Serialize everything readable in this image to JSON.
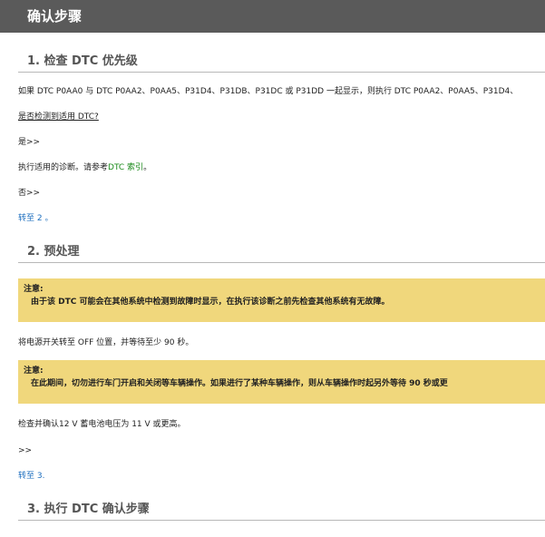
{
  "page_title": "确认步骤",
  "sections": [
    {
      "title": "1. 检查 DTC 优先级"
    },
    {
      "title": "2. 预处理"
    },
    {
      "title": "3. 执行 DTC 确认步骤"
    }
  ],
  "step1": {
    "intro": "如果 DTC P0AA0 与 DTC P0AA2、P0AA5、P31D4、P31DB、P31DC 或 P31DD 一起显示，则执行 DTC P0AA2、P0AA5、P31D4、",
    "question": "是否检测到适用 DTC?",
    "yes_label": "是>>",
    "yes_text_prefix": "执行适用的诊断。请参考",
    "yes_link": "DTC 索引",
    "yes_text_suffix": "。",
    "no_label": "否>>",
    "goto": "转至 2 。"
  },
  "step2": {
    "note1_title": "注意:",
    "note1_body": "由于该 DTC 可能会在其他系统中检测到故障时显示，在执行该诊断之前先检查其他系统有无故障。",
    "power_off": "将电源开关转至 OFF 位置，并等待至少 90 秒。",
    "note2_title": "注意:",
    "note2_body": "在此期间，切勿进行车门开启和关闭等车辆操作。如果进行了某种车辆操作，则从车辆操作时起另外等待 90 秒或更",
    "battery": "检查并确认12 V 蓄电池电压为 11 V 或更高。",
    "next_label": ">>",
    "goto": "转至 3."
  }
}
